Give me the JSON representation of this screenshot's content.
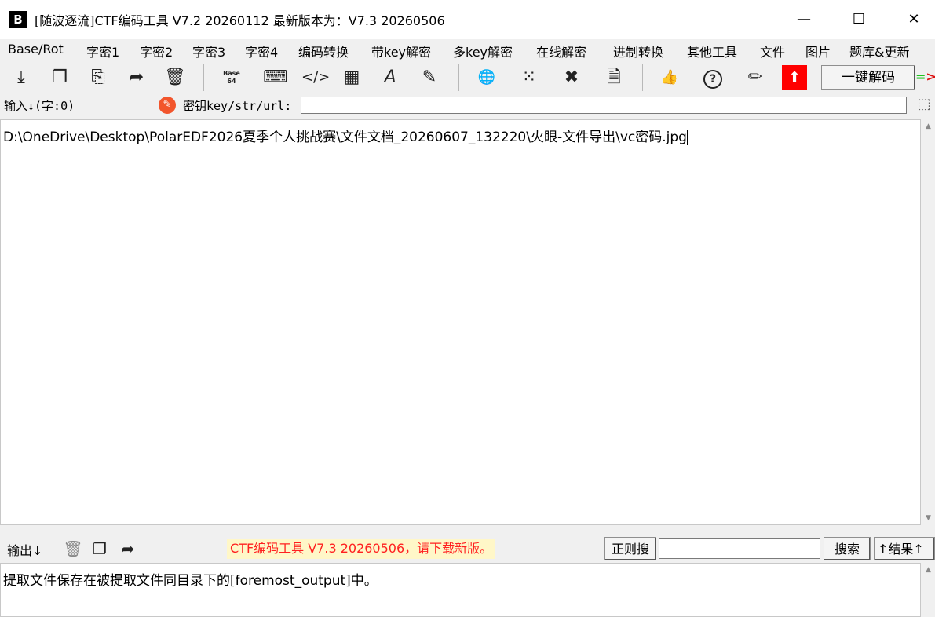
{
  "window": {
    "logo_glyph": "B",
    "title": "[随波逐流]CTF编码工具 V7.2 20260112    最新版本为：V7.3  20260506",
    "minimize_glyph": "—",
    "maximize_glyph": "☐",
    "close_glyph": "✕"
  },
  "menu": [
    "Base/Rot",
    "字密1",
    "字密2",
    "字密3",
    "字密4",
    "编码转换",
    "带key解密",
    "多key解密",
    "在线解密",
    "进制转换",
    "其他工具",
    "文件",
    "图片",
    "题库&更新"
  ],
  "toolbar": {
    "icons": [
      {
        "name": "import-icon",
        "glyph": "⤓"
      },
      {
        "name": "copy-icon",
        "glyph": "❐"
      },
      {
        "name": "paste-icon",
        "glyph": "⎘"
      },
      {
        "name": "share-icon",
        "glyph": "➦"
      },
      {
        "name": "delete-icon",
        "glyph": "🗑"
      },
      {
        "name": "base64-icon",
        "glyph": "Base 64"
      },
      {
        "name": "terminal-icon",
        "glyph": "⌨"
      },
      {
        "name": "code-icon",
        "glyph": "</>"
      },
      {
        "name": "calculator-icon",
        "glyph": "▦"
      },
      {
        "name": "font-icon",
        "glyph": "A"
      },
      {
        "name": "draw-icon",
        "glyph": "✎"
      },
      {
        "name": "globe-icon",
        "glyph": "🌐"
      },
      {
        "name": "grid-icon",
        "glyph": "⁙"
      },
      {
        "name": "tools-icon",
        "glyph": "✖"
      },
      {
        "name": "document-icon",
        "glyph": "🗎"
      },
      {
        "name": "thumbs-up-icon",
        "glyph": "👍"
      },
      {
        "name": "help-icon",
        "glyph": "?"
      },
      {
        "name": "edit-icon",
        "glyph": "✏"
      }
    ],
    "upgrade_glyph": "⬆",
    "decode_label": "一键解码",
    "arrow_eq": "=",
    "arrow_tip": ">"
  },
  "input": {
    "label": "输入↓(字:0)",
    "key_label": "密钥key/str/url:",
    "key_value": "",
    "text": "D:\\OneDrive\\Desktop\\PolarEDF2026夏季个人挑战赛\\文件文档_20260607_132220\\火眼-文件导出\\vc密码.jpg"
  },
  "output": {
    "label": "输出↓",
    "notice": "CTF编码工具 V7.3 20260506，请下载新版。",
    "regex_label": "正则搜",
    "search_value": "",
    "search_label": "搜索",
    "result_label": "↑结果↑",
    "text": "提取文件保存在被提取文件同目录下的[foremost_output]中。"
  },
  "colors": {
    "upgrade_red": "#ff0000",
    "notice_text": "#ff2020",
    "notice_bg": "#fff7c8",
    "pen_orange": "#f2552c"
  }
}
